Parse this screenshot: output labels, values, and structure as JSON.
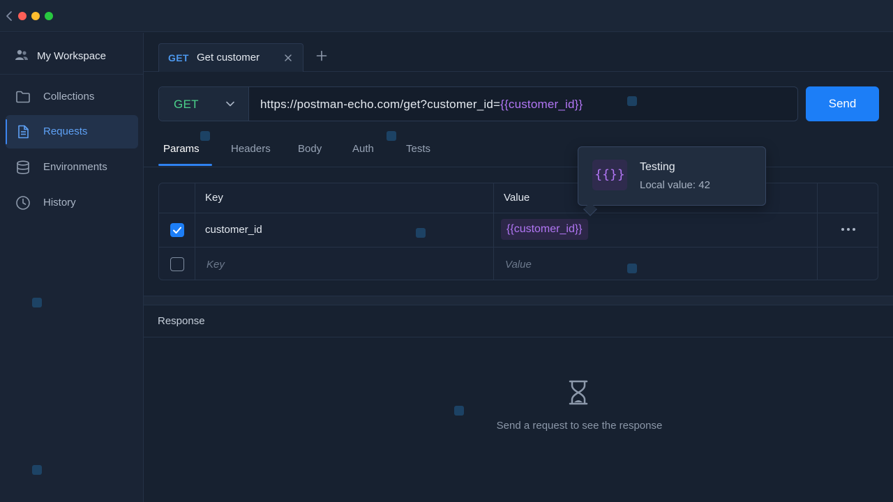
{
  "window": {
    "traffic_lights": [
      "close",
      "minimize",
      "maximize"
    ],
    "colors": {
      "red": "#ff5f57",
      "yellow": "#febc2e",
      "green": "#28c840"
    }
  },
  "sidebar": {
    "workspace_label": "My Workspace",
    "items": [
      {
        "label": "Collections",
        "icon": "folder-icon",
        "active": false
      },
      {
        "label": "Requests",
        "icon": "document-icon",
        "active": true
      },
      {
        "label": "Environments",
        "icon": "database-icon",
        "active": false
      },
      {
        "label": "History",
        "icon": "clock-icon",
        "active": false
      }
    ]
  },
  "tabs": {
    "items": [
      {
        "method": "GET",
        "name": "Get customer"
      }
    ],
    "new_tab_icon": "plus-icon"
  },
  "request": {
    "method": "GET",
    "url_prefix": "https://postman-echo.com/get?customer_id=",
    "url_variable": "{{customer_id}}",
    "send_label": "Send"
  },
  "subtabs": [
    "Params",
    "Headers",
    "Body",
    "Auth",
    "Tests"
  ],
  "params": {
    "headers": {
      "key": "Key",
      "value": "Value"
    },
    "rows": [
      {
        "checked": true,
        "key": "customer_id",
        "value": "{{customer_id}}"
      }
    ],
    "empty_row": {
      "checked": false,
      "key_placeholder": "Key",
      "value_placeholder": "Value"
    }
  },
  "tooltip": {
    "icon_text": "{{}}",
    "title": "Testing",
    "subtitle": "Local value: 42"
  },
  "response": {
    "title": "Response",
    "empty_message": "Send a request to see the response",
    "icon": "hourglass-icon"
  },
  "colors": {
    "accent_blue": "#1c7ef7",
    "method_get": "#4bd18a",
    "variable_purple": "#b276f5",
    "background": "#172130"
  }
}
